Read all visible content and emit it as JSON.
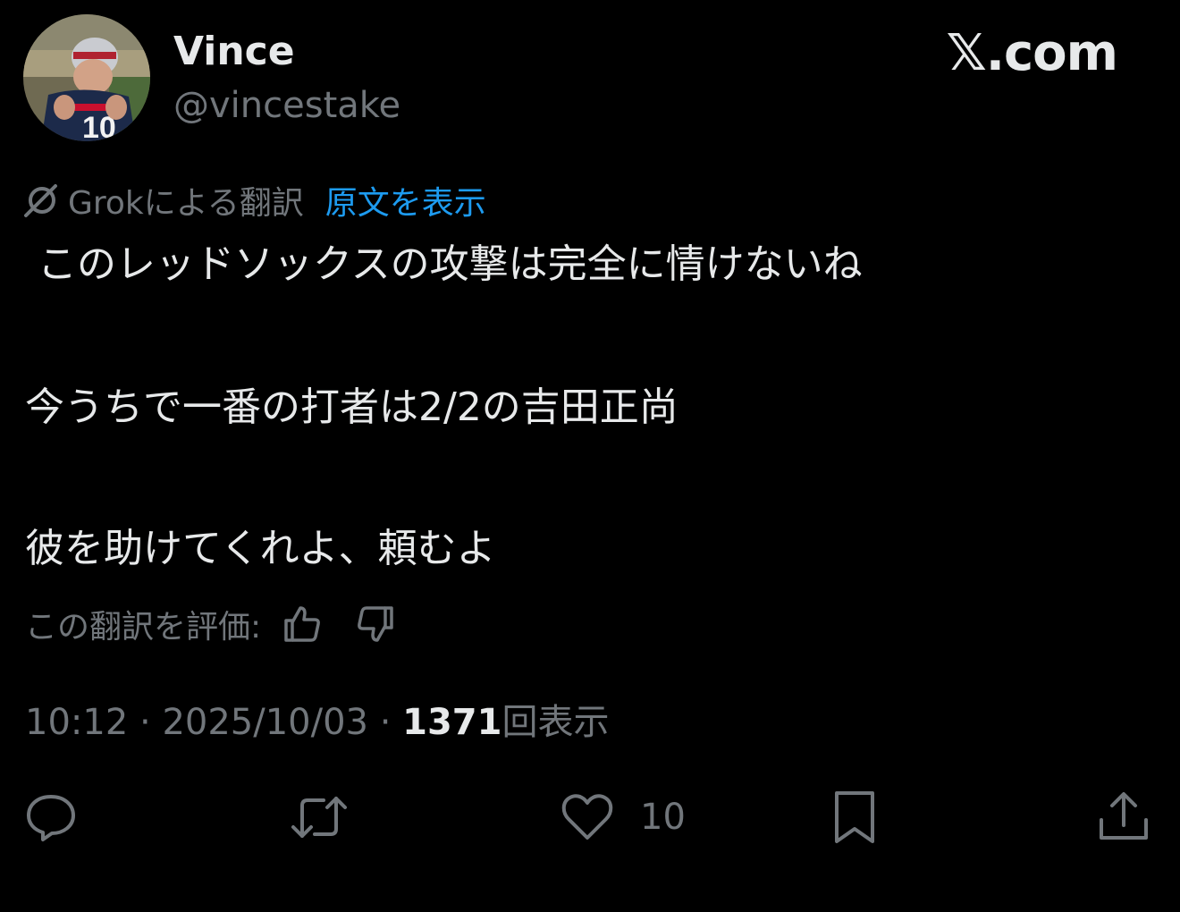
{
  "author": {
    "display_name": "Vince",
    "handle": "@vincestake",
    "avatar_jersey_number": "10"
  },
  "site_logo": "𝕏.com",
  "translation": {
    "grok_label": "Grokによる翻訳",
    "show_original_label": "原文を表示"
  },
  "tweet": {
    "lines": [
      "このレッドソックスの攻撃は完全に情けないね",
      "今うちで一番の打者は2/2の吉田正尚",
      "彼を助けてくれよ、頼むよ"
    ]
  },
  "rate_translation": {
    "label": "この翻訳を評価:",
    "icons": [
      "thumbs-up-icon",
      "thumbs-down-icon"
    ]
  },
  "meta": {
    "time": "10:12",
    "separator": " · ",
    "date": "2025/10/03",
    "views_count": "1371",
    "views_label": "回表示"
  },
  "actions": {
    "reply_icon": "reply-icon",
    "retweet_icon": "retweet-icon",
    "like_icon": "heart-icon",
    "like_count": "10",
    "bookmark_icon": "bookmark-icon",
    "share_icon": "share-icon"
  },
  "colors": {
    "background": "#000000",
    "primary_text": "#e7e9ea",
    "secondary_text": "#71767b",
    "link": "#1d9bf0"
  }
}
